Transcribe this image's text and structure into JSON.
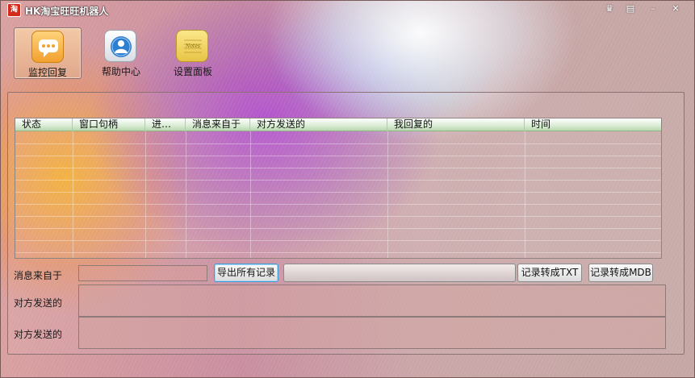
{
  "window": {
    "title": "HK淘宝旺旺机器人",
    "logo_text": "淘",
    "controls": [
      {
        "name": "skin-icon",
        "glyph": "♛"
      },
      {
        "name": "menu-icon",
        "glyph": "▤"
      },
      {
        "name": "minimize-icon",
        "glyph": "–"
      },
      {
        "name": "close-icon",
        "glyph": "✕"
      }
    ]
  },
  "toolbar": {
    "monitor_label": "监控回复",
    "help_label": "帮助中心",
    "settings_label": "设置面板",
    "settings_icon_text": "Notes"
  },
  "grid": {
    "columns": [
      "状态",
      "窗口句柄",
      "进…",
      "消息来自于",
      "对方发送的",
      "我回复的",
      "时间"
    ],
    "rows": []
  },
  "form": {
    "from_label": "消息来自于",
    "from_value": "",
    "export_all_label": "导出所有记录",
    "path_value": "",
    "to_txt_label": "记录转成TXT",
    "to_mdb_label": "记录转成MDB",
    "sent_label_1": "对方发送的",
    "sent_value_1": "",
    "sent_label_2": "对方发送的",
    "sent_value_2": ""
  },
  "colors": {
    "accent_orange": "#f2a12e",
    "header_green": "#b9d7b0",
    "focus_blue": "#3a9bd9"
  }
}
